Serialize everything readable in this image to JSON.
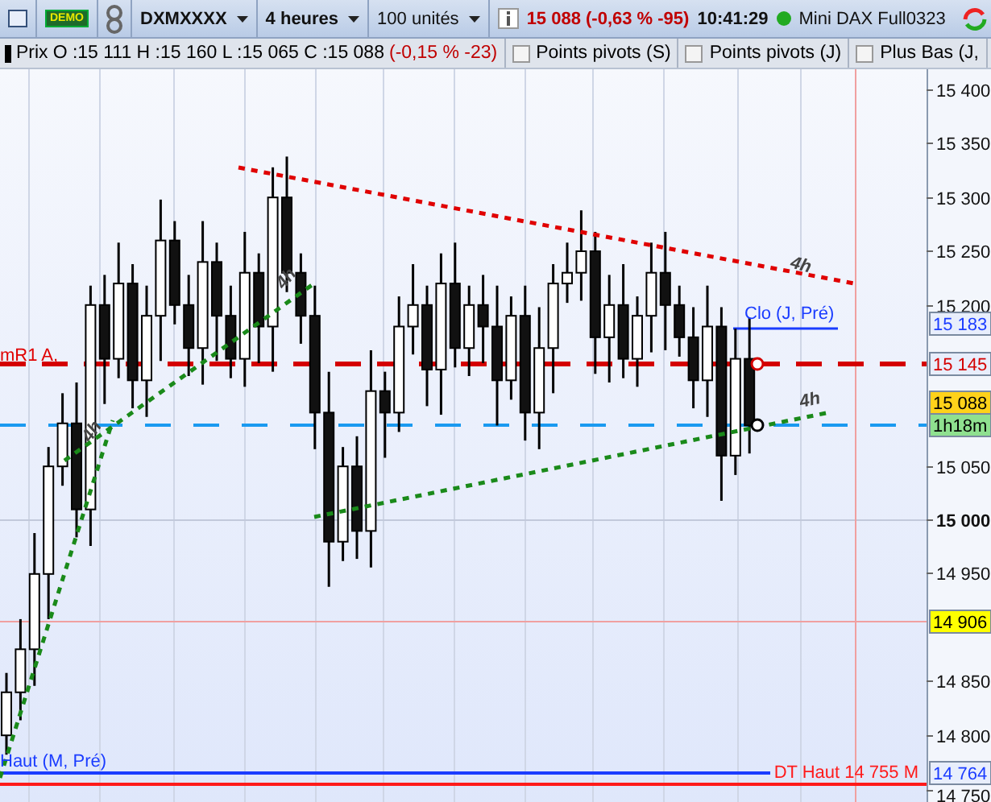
{
  "toolbar": {
    "badge": "DEMO",
    "symbol": "DXMXXXX",
    "timeframe": "4 heures",
    "units": "100 unités",
    "quote": "15 088 (-0,63 % -95)",
    "time": "10:41:29",
    "instrument": "Mini DAX Full0323",
    "connected": true
  },
  "legend": {
    "price_label": "Prix",
    "ohlc": "O :15 111 H :15 160 L :15 065 C :15 088",
    "change": "(-0,15 % -23)",
    "indicators": [
      {
        "label": "Points pivots (S)",
        "checked": false
      },
      {
        "label": "Points pivots (J)",
        "checked": false
      },
      {
        "label": "Plus Bas (J,",
        "checked": false
      }
    ]
  },
  "chart": {
    "y_ticks": [
      {
        "label": "15 400",
        "major": false
      },
      {
        "label": "15 350",
        "major": false
      },
      {
        "label": "15 300",
        "major": false
      },
      {
        "label": "15 250",
        "major": false
      },
      {
        "label": "15 200",
        "major": false
      },
      {
        "label": "15 050",
        "major": false
      },
      {
        "label": "15 000",
        "major": true
      },
      {
        "label": "14 950",
        "major": false
      },
      {
        "label": "14 850",
        "major": false
      },
      {
        "label": "14 800",
        "major": false
      },
      {
        "label": "14 750",
        "major": false
      }
    ],
    "price_tags": [
      {
        "text": "15 183",
        "color": "#1a3cff",
        "kind": "level"
      },
      {
        "text": "15 145",
        "color": "#d40000",
        "kind": "level"
      },
      {
        "text": "15 088",
        "color": "#000000",
        "kind": "last"
      },
      {
        "text": "1h18m",
        "color": "#000000",
        "kind": "countdown"
      },
      {
        "text": "14 906",
        "color": "#000000",
        "kind": "cursor"
      },
      {
        "text": "14 764",
        "color": "#1a3cff",
        "kind": "level"
      }
    ],
    "line_labels": [
      {
        "text": "mR1 A,",
        "color": "#e00000"
      },
      {
        "text": "Clo (J, Pré)",
        "color": "#1a3cff"
      },
      {
        "text": "Haut (M, Pré)",
        "color": "#1a3cff"
      },
      {
        "text": "DT Haut 14 755 M",
        "color": "#ff1a1a"
      }
    ],
    "trendlines": [
      {
        "label": "4h",
        "color": "#e00000"
      },
      {
        "label": "4h",
        "color": "#1a8a1a"
      },
      {
        "label": "4h",
        "color": "#1a8a1a"
      },
      {
        "label": "4h",
        "color": "#1a8a1a"
      }
    ]
  }
}
